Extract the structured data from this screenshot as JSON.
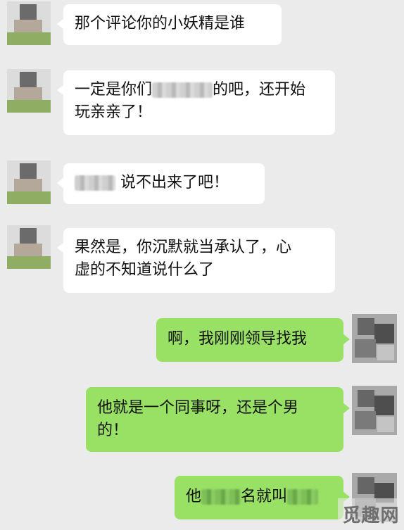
{
  "messages": [
    {
      "side": "in",
      "text": "那个评论你的小妖精是谁"
    },
    {
      "side": "in",
      "parts": [
        "一定是你们",
        "的吧，还开始",
        "玩亲亲了！"
      ]
    },
    {
      "side": "in",
      "parts": [
        "说不出来了吧！"
      ]
    },
    {
      "side": "in",
      "parts": [
        "果然是，你沉默就当承认了，心",
        "虚的不知道说什么了"
      ]
    },
    {
      "side": "out",
      "text": "啊，我刚刚领导找我"
    },
    {
      "side": "out",
      "parts": [
        "他就是一个同事呀，还是个男",
        "的！"
      ]
    },
    {
      "side": "out",
      "parts": [
        "他",
        "名就叫"
      ]
    }
  ],
  "watermark": "觅趣网",
  "colors": {
    "background": "#ebebeb",
    "incoming_bubble": "#ffffff",
    "outgoing_bubble": "#98e165"
  },
  "icons": [
    "contact-avatar-icon",
    "self-avatar-icon"
  ]
}
